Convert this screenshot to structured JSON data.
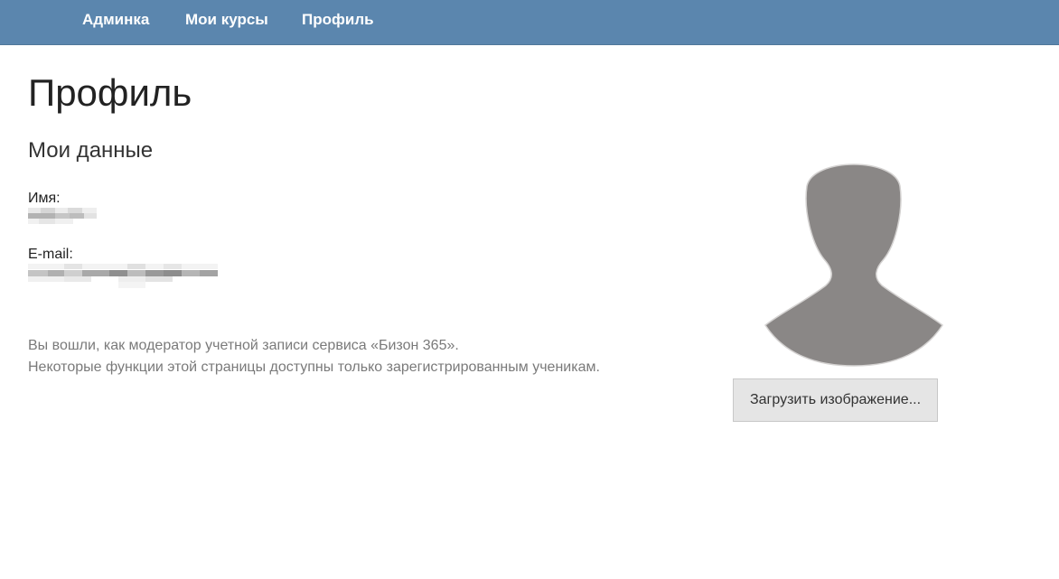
{
  "nav": {
    "items": [
      {
        "label": "Админка"
      },
      {
        "label": "Мои курсы"
      },
      {
        "label": "Профиль"
      }
    ]
  },
  "page": {
    "title": "Профиль",
    "section_title": "Мои данные"
  },
  "fields": {
    "name_label": "Имя:",
    "email_label": "E-mail:"
  },
  "notes": {
    "line1": "Вы вошли, как модератор учетной записи сервиса «Бизон 365».",
    "line2": "Некоторые функции этой страницы доступны только зарегистрированным ученикам."
  },
  "avatar": {
    "icon": "user-silhouette-icon",
    "color": "#8a8786"
  },
  "upload": {
    "label": "Загрузить изображение..."
  },
  "colors": {
    "navbar": "#5b86ae",
    "button_bg": "#e5e5e5"
  }
}
